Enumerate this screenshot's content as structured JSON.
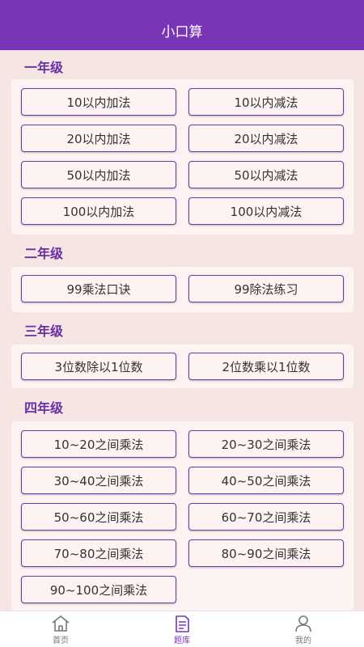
{
  "header": {
    "title": "小口算"
  },
  "sections": [
    {
      "title": "一年级",
      "items": [
        "10以内加法",
        "10以内减法",
        "20以内加法",
        "20以内减法",
        "50以内加法",
        "50以内减法",
        "100以内加法",
        "100以内减法"
      ]
    },
    {
      "title": "二年级",
      "items": [
        "99乘法口诀",
        "99除法练习"
      ]
    },
    {
      "title": "三年级",
      "items": [
        "3位数除以1位数",
        "2位数乘以1位数"
      ]
    },
    {
      "title": "四年级",
      "items": [
        "10~20之间乘法",
        "20~30之间乘法",
        "30~40之间乘法",
        "40~50之间乘法",
        "50~60之间乘法",
        "60~70之间乘法",
        "70~80之间乘法",
        "80~90之间乘法",
        "90~100之间乘法"
      ]
    }
  ],
  "tabbar": {
    "tabs": [
      {
        "label": "首页",
        "icon": "home-icon",
        "active": false
      },
      {
        "label": "题库",
        "icon": "document-icon",
        "active": true
      },
      {
        "label": "我的",
        "icon": "user-icon",
        "active": false
      }
    ]
  },
  "colors": {
    "primary": "#7a35b7",
    "background": "#f6e6e3",
    "panel": "#fdf3f2"
  }
}
